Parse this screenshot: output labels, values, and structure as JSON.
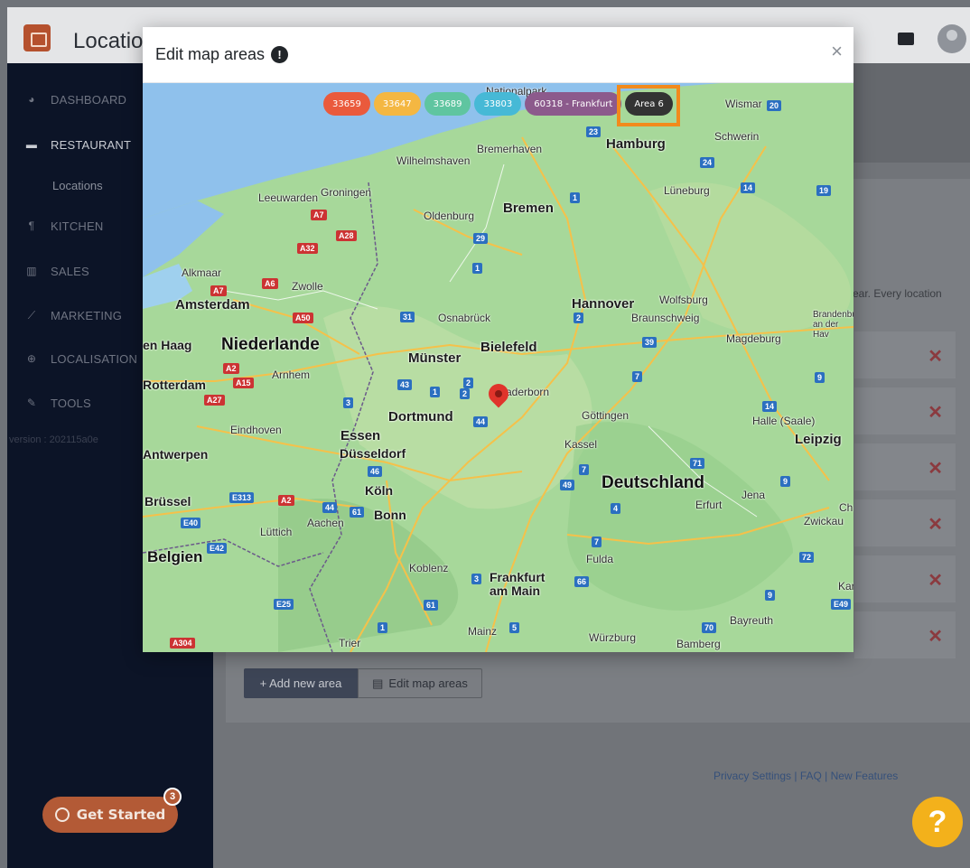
{
  "app": {
    "title": "Location"
  },
  "sidebar": {
    "items": [
      {
        "label": "DASHBOARD",
        "icon": "dashboard-icon"
      },
      {
        "label": "RESTAURANT",
        "icon": "store-icon"
      },
      {
        "label": "KITCHEN",
        "icon": "utensils-icon"
      },
      {
        "label": "SALES",
        "icon": "bar-chart-icon"
      },
      {
        "label": "MARKETING",
        "icon": "line-chart-icon"
      },
      {
        "label": "LOCALISATION",
        "icon": "globe-icon"
      },
      {
        "label": "TOOLS",
        "icon": "wrench-icon"
      }
    ],
    "sub_item": "Locations",
    "version": "version : 202115a0e"
  },
  "get_started": {
    "label": "Get Started",
    "badge": "3"
  },
  "content": {
    "side_text": "ear. Every location",
    "add_area_label": "+ Add new area",
    "edit_map_label": "Edit map areas",
    "footer": "Privacy Settings | FAQ | New Features",
    "help": "?"
  },
  "modal": {
    "title": "Edit map areas",
    "info_icon": "!",
    "close": "×",
    "chips": [
      {
        "label": "33659",
        "color": "#ea5a3c"
      },
      {
        "label": "33647",
        "color": "#f4b742"
      },
      {
        "label": "33689",
        "color": "#5fc5a0"
      },
      {
        "label": "33803",
        "color": "#46b9d6"
      },
      {
        "label": "60318 - Frankfurt",
        "color": "#8c5a8c"
      },
      {
        "label": "Area 6",
        "color": "#333333"
      }
    ],
    "highlight_color": "#f28a1c"
  },
  "map": {
    "labels": [
      {
        "text": "Nationalpark",
        "cls": ""
      },
      {
        "text": "Wismar",
        "cls": ""
      },
      {
        "text": "Schwerin",
        "cls": ""
      },
      {
        "text": "Hamburg",
        "cls": "big"
      },
      {
        "text": "Bremerhaven",
        "cls": ""
      },
      {
        "text": "Wilhelmshaven",
        "cls": ""
      },
      {
        "text": "Lüneburg",
        "cls": ""
      },
      {
        "text": "Leeuwarden",
        "cls": ""
      },
      {
        "text": "Groningen",
        "cls": ""
      },
      {
        "text": "Bremen",
        "cls": "big"
      },
      {
        "text": "Oldenburg",
        "cls": ""
      },
      {
        "text": "Alkmaar",
        "cls": ""
      },
      {
        "text": "Zwolle",
        "cls": ""
      },
      {
        "text": "Amsterdam",
        "cls": "big"
      },
      {
        "text": "Hannover",
        "cls": "big"
      },
      {
        "text": "Wolfsburg",
        "cls": ""
      },
      {
        "text": "Braunschweig",
        "cls": ""
      },
      {
        "text": "Brandenbur an der Hav",
        "cls": ""
      },
      {
        "text": "Osnabrück",
        "cls": ""
      },
      {
        "text": "Magdeburg",
        "cls": ""
      },
      {
        "text": "en Haag",
        "cls": "big"
      },
      {
        "text": "Niederlande",
        "cls": "country"
      },
      {
        "text": "Münster",
        "cls": "big"
      },
      {
        "text": "Bielefeld",
        "cls": "big"
      },
      {
        "text": "Rotterdam",
        "cls": "big"
      },
      {
        "text": "Arnhem",
        "cls": ""
      },
      {
        "text": "Paderborn",
        "cls": ""
      },
      {
        "text": "Dortmund",
        "cls": "big"
      },
      {
        "text": "Göttingen",
        "cls": ""
      },
      {
        "text": "Halle (Saale)",
        "cls": ""
      },
      {
        "text": "Eindhoven",
        "cls": ""
      },
      {
        "text": "Essen",
        "cls": "big"
      },
      {
        "text": "Kassel",
        "cls": ""
      },
      {
        "text": "Leipzig",
        "cls": "big"
      },
      {
        "text": "Antwerpen",
        "cls": "big"
      },
      {
        "text": "Düsseldorf",
        "cls": "big"
      },
      {
        "text": "Deutschland",
        "cls": "country"
      },
      {
        "text": "Köln",
        "cls": "big"
      },
      {
        "text": "Jena",
        "cls": ""
      },
      {
        "text": "Brüssel",
        "cls": "big"
      },
      {
        "text": "Bonn",
        "cls": "big"
      },
      {
        "text": "Erfurt",
        "cls": ""
      },
      {
        "text": "Ch",
        "cls": ""
      },
      {
        "text": "Aachen",
        "cls": ""
      },
      {
        "text": "Zwickau",
        "cls": ""
      },
      {
        "text": "Lüttich",
        "cls": ""
      },
      {
        "text": "Belgien",
        "cls": "country"
      },
      {
        "text": "Fulda",
        "cls": ""
      },
      {
        "text": "Koblenz",
        "cls": ""
      },
      {
        "text": "Frankfurt am Main",
        "cls": "big"
      },
      {
        "text": "Kar",
        "cls": ""
      },
      {
        "text": "Bayreuth",
        "cls": ""
      },
      {
        "text": "Mainz",
        "cls": ""
      },
      {
        "text": "Würzburg",
        "cls": ""
      },
      {
        "text": "Bamberg",
        "cls": ""
      },
      {
        "text": "Trier",
        "cls": ""
      }
    ],
    "roads": [
      {
        "label": "20",
        "type": "b"
      },
      {
        "label": "23",
        "type": "b"
      },
      {
        "label": "24",
        "type": "b"
      },
      {
        "label": "14",
        "type": "b"
      },
      {
        "label": "19",
        "type": "b"
      },
      {
        "label": "1",
        "type": "b"
      },
      {
        "label": "A7",
        "type": "a"
      },
      {
        "label": "A28",
        "type": "a"
      },
      {
        "label": "29",
        "type": "b"
      },
      {
        "label": "A32",
        "type": "a"
      },
      {
        "label": "1",
        "type": "b"
      },
      {
        "label": "A7",
        "type": "a"
      },
      {
        "label": "A6",
        "type": "a"
      },
      {
        "label": "A50",
        "type": "a"
      },
      {
        "label": "31",
        "type": "b"
      },
      {
        "label": "2",
        "type": "b"
      },
      {
        "label": "2",
        "type": "b"
      },
      {
        "label": "39",
        "type": "b"
      },
      {
        "label": "A2",
        "type": "a"
      },
      {
        "label": "A15",
        "type": "a"
      },
      {
        "label": "43",
        "type": "b"
      },
      {
        "label": "1",
        "type": "b"
      },
      {
        "label": "2",
        "type": "b"
      },
      {
        "label": "7",
        "type": "b"
      },
      {
        "label": "9",
        "type": "b"
      },
      {
        "label": "A27",
        "type": "a"
      },
      {
        "label": "3",
        "type": "b"
      },
      {
        "label": "44",
        "type": "b"
      },
      {
        "label": "14",
        "type": "b"
      },
      {
        "label": "46",
        "type": "b"
      },
      {
        "label": "7",
        "type": "b"
      },
      {
        "label": "71",
        "type": "b"
      },
      {
        "label": "49",
        "type": "b"
      },
      {
        "label": "9",
        "type": "b"
      },
      {
        "label": "E313",
        "type": "b"
      },
      {
        "label": "A2",
        "type": "a"
      },
      {
        "label": "44",
        "type": "b"
      },
      {
        "label": "61",
        "type": "b"
      },
      {
        "label": "4",
        "type": "b"
      },
      {
        "label": "E40",
        "type": "b"
      },
      {
        "label": "E42",
        "type": "b"
      },
      {
        "label": "7",
        "type": "b"
      },
      {
        "label": "72",
        "type": "b"
      },
      {
        "label": "3",
        "type": "b"
      },
      {
        "label": "66",
        "type": "b"
      },
      {
        "label": "9",
        "type": "b"
      },
      {
        "label": "E49",
        "type": "b"
      },
      {
        "label": "E25",
        "type": "b"
      },
      {
        "label": "61",
        "type": "b"
      },
      {
        "label": "1",
        "type": "b"
      },
      {
        "label": "5",
        "type": "b"
      },
      {
        "label": "70",
        "type": "b"
      },
      {
        "label": "A304",
        "type": "a"
      }
    ]
  }
}
